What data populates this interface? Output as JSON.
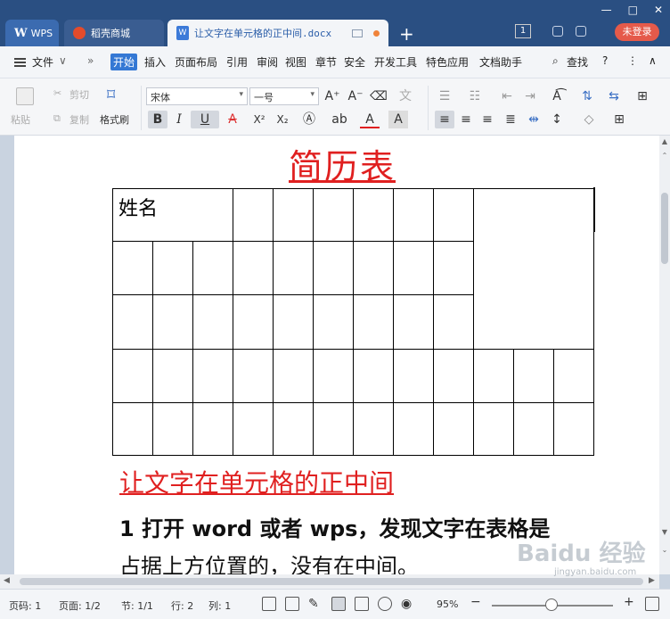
{
  "titlebar": {
    "tab_wps_logo": "W",
    "tab_wps_label": "WPS",
    "tab_shop_label": "稻壳商城",
    "tab_doc_label": "让文字在单元格的正中间.docx",
    "add_tab": "+",
    "page_count": "1",
    "login_label": "未登录",
    "window_buttons": [
      "—",
      "□",
      "✕"
    ]
  },
  "menubar": {
    "file_label": "文件",
    "items": [
      "开始",
      "插入",
      "页面布局",
      "引用",
      "审阅",
      "视图",
      "章节",
      "安全",
      "开发工具",
      "特色应用",
      "文档助手"
    ],
    "search_label": "查找",
    "help": "?",
    "more": "⋮",
    "collapse": "∧"
  },
  "ribbon": {
    "paste": "粘贴",
    "cut": "剪切",
    "copy": "复制",
    "format_painter": "格式刷",
    "font_family": "宋体",
    "font_size": "一号",
    "bold": "B",
    "italic": "I",
    "underline": "U",
    "superscript": "X²",
    "subscript": "X₂"
  },
  "document": {
    "heading": "简历表",
    "name_cell": "姓名",
    "sub_heading": "让文字在单元格的正中间",
    "body_line1": "1 打开 word 或者 wps，发现文字在表格是",
    "body_line2": "占据上方位置的，没有在中间。"
  },
  "statusbar": {
    "page_num": "页码: 1",
    "pages": "页面: 1/2",
    "section": "节: 1/1",
    "row": "行: 2",
    "col": "列: 1",
    "zoom": "95%",
    "zoom_minus": "−",
    "zoom_plus": "+"
  },
  "watermark": {
    "text": "Baidu 经验",
    "sub": "jingyan.baidu.com"
  }
}
